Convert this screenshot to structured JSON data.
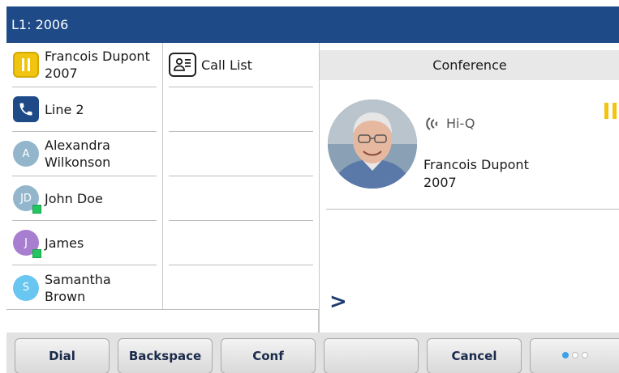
{
  "title_bar": {
    "line_label": "L1: 2006"
  },
  "line_keys": [
    {
      "name": "Francois Dupont",
      "number": "2007",
      "type": "held-call"
    },
    {
      "name": "Line 2",
      "type": "line"
    },
    {
      "name": "Alexandra",
      "name2": "Wilkonson",
      "initials": "A",
      "color": "#93b6cc"
    },
    {
      "name": "John Doe",
      "initials": "JD",
      "color": "#93b6cc",
      "presence": "available"
    },
    {
      "name": "James",
      "initials": "J",
      "color": "#a77ed0",
      "presence": "available"
    },
    {
      "name": "Samantha",
      "name2": "Brown",
      "initials": "S",
      "color": "#69c6f0"
    }
  ],
  "call_list": {
    "label": "Call List"
  },
  "call_panel": {
    "header": "Conference",
    "audio_badge": "Hi-Q",
    "caller_name": "Francois Dupont",
    "caller_number": "2007",
    "more": ">"
  },
  "softkeys": [
    "Dial",
    "Backspace",
    "Conf",
    "",
    "Cancel"
  ],
  "pager": {
    "pages": 3,
    "current": 1
  },
  "colors": {
    "title_bar": "#1e4a88",
    "hold": "#f1c40f",
    "presence": "#22c55e",
    "dot_active": "#3aa0e8"
  }
}
